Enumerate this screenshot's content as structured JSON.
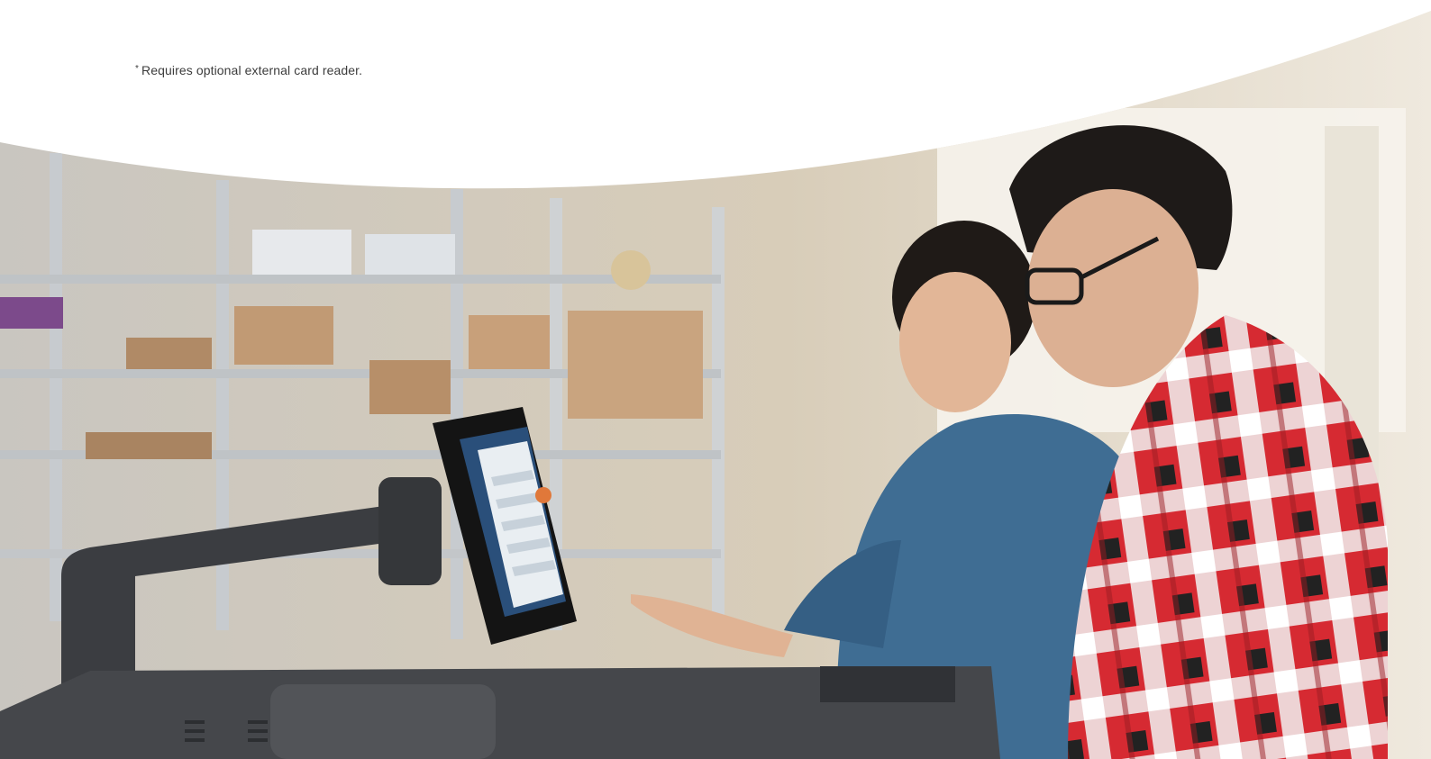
{
  "footnote": {
    "marker": "*",
    "text": "Requires optional external card reader."
  },
  "photo": {
    "colors": {
      "background": "#ffffff",
      "wall": "#d9d2c6",
      "shelf": "#b9bcbf",
      "device": "#3b3d41",
      "shirt_red": "#d8242e",
      "denim": "#3d6b92"
    }
  }
}
